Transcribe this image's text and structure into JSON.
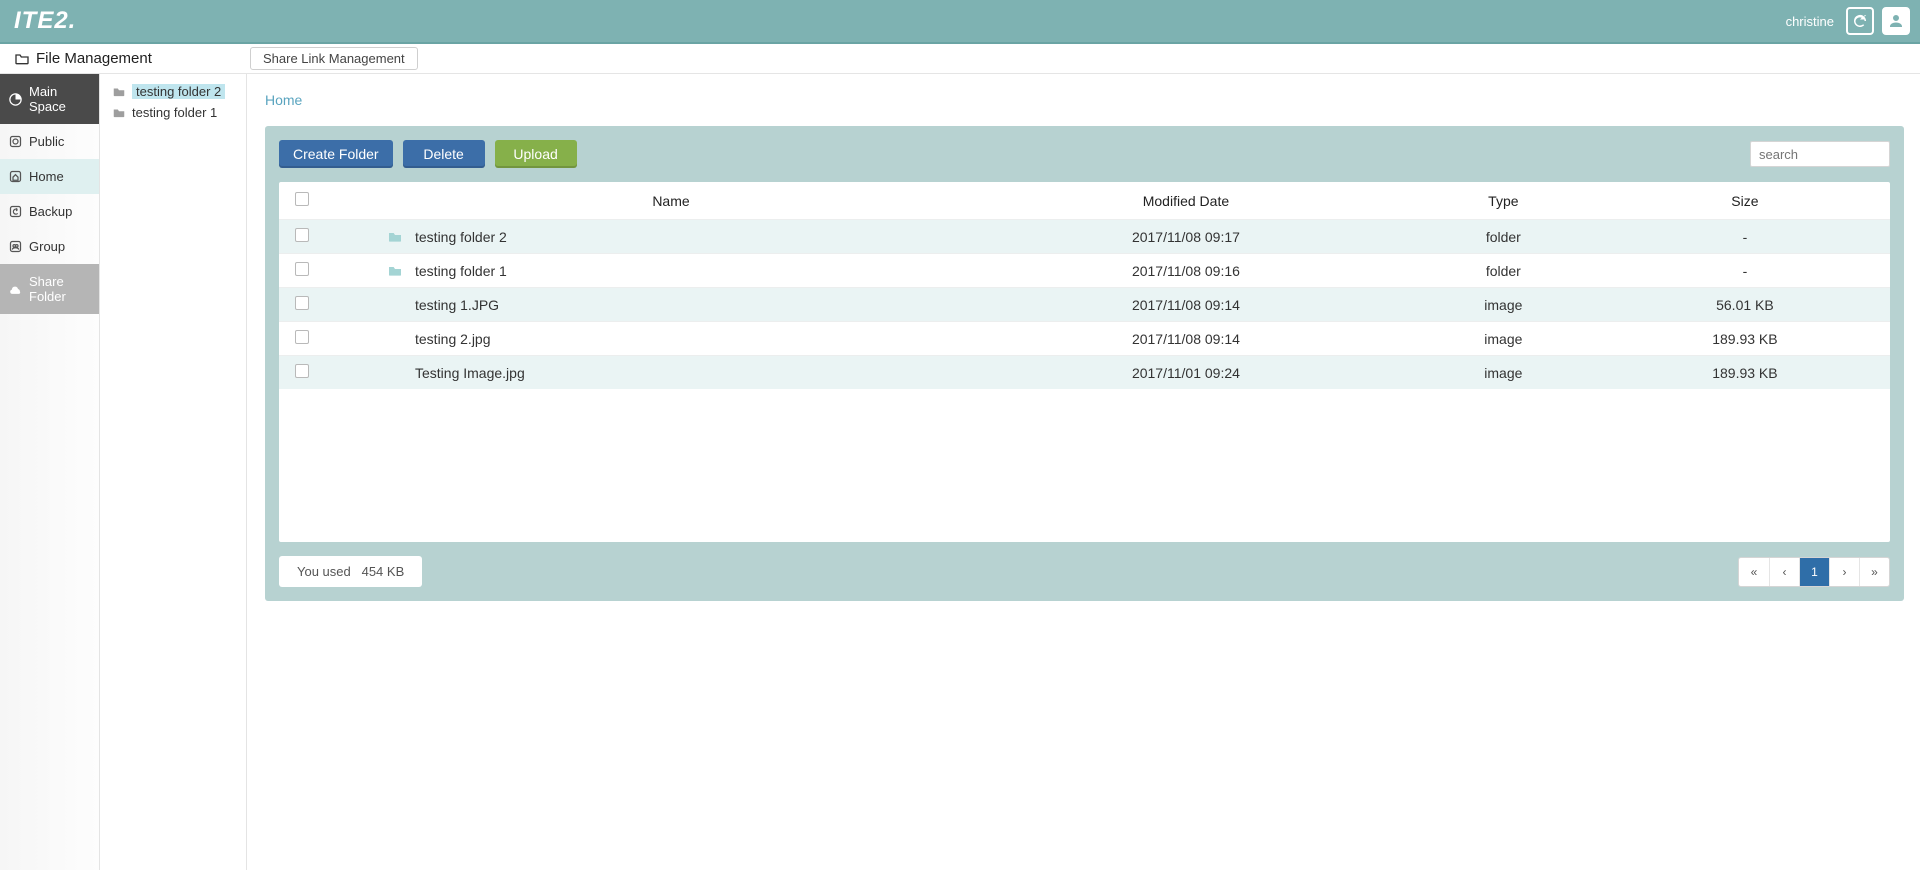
{
  "brand": "ITE2.",
  "topbar": {
    "username": "christine"
  },
  "secondbar": {
    "title": "File Management",
    "tab": "Share Link Management"
  },
  "sidebar": {
    "items": [
      {
        "label": "Main Space",
        "icon": "pie"
      },
      {
        "label": "Public",
        "icon": "bracket"
      },
      {
        "label": "Home",
        "icon": "home"
      },
      {
        "label": "Backup",
        "icon": "undo"
      },
      {
        "label": "Group",
        "icon": "group"
      },
      {
        "label": "Share Folder",
        "icon": "cloud"
      }
    ]
  },
  "tree": {
    "items": [
      {
        "label": "testing folder 2",
        "selected": true
      },
      {
        "label": "testing folder 1",
        "selected": false
      }
    ]
  },
  "main": {
    "breadcrumb": "Home",
    "toolbar": {
      "create_label": "Create Folder",
      "delete_label": "Delete",
      "upload_label": "Upload",
      "search_placeholder": "search"
    },
    "table": {
      "headers": {
        "name": "Name",
        "modified": "Modified Date",
        "type": "Type",
        "size": "Size"
      },
      "rows": [
        {
          "name": "testing folder 2",
          "modified": "2017/11/08 09:17",
          "type": "folder",
          "size": "-",
          "icon": "folder"
        },
        {
          "name": "testing folder 1",
          "modified": "2017/11/08 09:16",
          "type": "folder",
          "size": "-",
          "icon": "folder"
        },
        {
          "name": "testing 1.JPG",
          "modified": "2017/11/08 09:14",
          "type": "image",
          "size": "56.01 KB",
          "icon": "none"
        },
        {
          "name": "testing 2.jpg",
          "modified": "2017/11/08 09:14",
          "type": "image",
          "size": "189.93 KB",
          "icon": "none"
        },
        {
          "name": "Testing Image.jpg",
          "modified": "2017/11/01 09:24",
          "type": "image",
          "size": "189.93 KB",
          "icon": "none"
        }
      ]
    },
    "footer": {
      "usage_prefix": "You used",
      "usage_value": "454 KB",
      "pager": {
        "current": "1"
      }
    }
  }
}
